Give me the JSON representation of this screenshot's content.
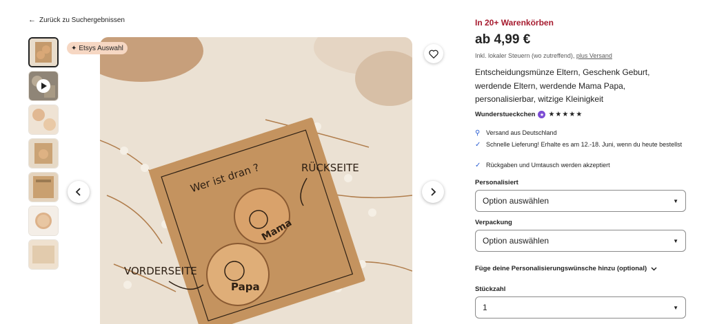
{
  "nav": {
    "back_label": "Zurück zu Suchergebnissen"
  },
  "gallery": {
    "badge_label": "Etsys Auswahl",
    "image_texts": {
      "card_title": "Wer ist dran ?",
      "back_label": "RÜCKSEITE",
      "front_label": "VORDERSEITE",
      "coin_front": "Wer ist Dran? Papa",
      "coin_back": "Wer ist Dran? Mama"
    }
  },
  "product": {
    "cart_note": "In 20+ Warenkörben",
    "price": "ab 4,99 €",
    "tax_note": "Inkl. lokaler Steuern (wo zutreffend), ",
    "shipping_link": "plus Versand",
    "title": "Entscheidungsmünze Eltern, Geschenk Geburt, werdende Eltern, werdende Mama Papa, personalisierbar, witzige Kleinigkeit",
    "shop_name": "Wunderstueckchen",
    "rating_stars": "★★★★★",
    "perks": [
      {
        "icon": "location-pin-icon",
        "text": "Versand aus Deutschland"
      },
      {
        "icon": "checkmark-icon",
        "text": "Schnelle Lieferung! Erhalte es am 12.-18. Juni, wenn du heute bestellst"
      },
      {
        "icon": "checkmark-icon",
        "text": "Rückgaben und Umtausch werden akzeptiert"
      }
    ]
  },
  "options": {
    "personalisiert_label": "Personalisiert",
    "personalisiert_value": "Option auswählen",
    "verpackung_label": "Verpackung",
    "verpackung_value": "Option auswählen",
    "personalization_toggle": "Füge deine Personalisierungswünsche hinzu (optional)",
    "quantity_label": "Stückzahl",
    "quantity_value": "1"
  },
  "colors": {
    "accent_red": "#a61a2e",
    "shop_badge": "#7b4bd4",
    "perk_icon": "#2c5fd3"
  }
}
